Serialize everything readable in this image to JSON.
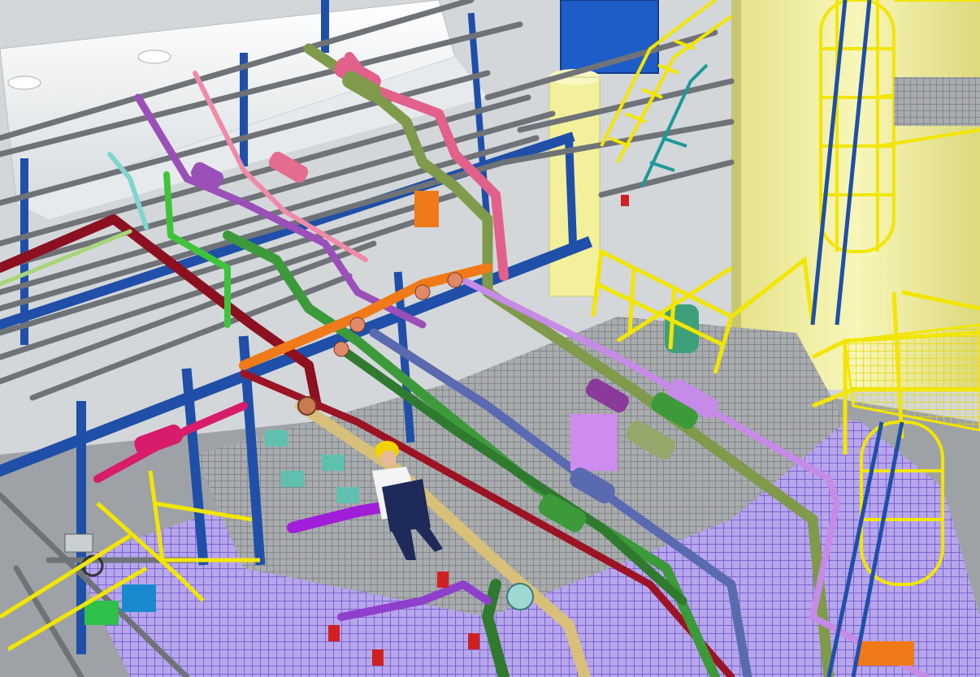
{
  "scene": {
    "subject": "3d-plant-piping-model",
    "colors": {
      "structure_blue": "#1f4fa8",
      "ladder_yellow": "#f2e200",
      "vessel_yellow": "#f0ee9a",
      "grating_purple": "#9a7fe0",
      "grating_gray": "#8f9296",
      "pipe_gray": "#6f7377",
      "pipe_maroon": "#8c1020",
      "pipe_pink": "#e2608a",
      "pipe_violet": "#9b4fb8",
      "pipe_green": "#3c9a3a",
      "pipe_olive": "#7f9a4a",
      "pipe_steel_blue": "#5a6ab0",
      "pipe_tan": "#d8c07a",
      "pipe_lilac": "#c68ae8",
      "fitting_orange": "#f07a18",
      "handrail_yellow": "#f2e600",
      "tank_white": "#f4f6f6",
      "vessel_blue": "#1e5cc8"
    },
    "icons": [
      "valve-handwheel-icon",
      "gate-valve-icon",
      "flange-icon",
      "worker-figure-icon",
      "cage-ladder-icon"
    ]
  }
}
